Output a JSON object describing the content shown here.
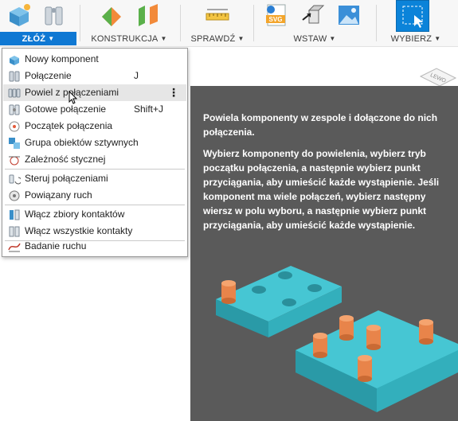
{
  "toolbar": {
    "groups": [
      {
        "label": "ZŁÓŻ",
        "caret": "▼"
      },
      {
        "label": "KONSTRUKCJA",
        "caret": "▼"
      },
      {
        "label": "SPRAWDŹ",
        "caret": "▼"
      },
      {
        "label": "WSTAW",
        "caret": "▼"
      },
      {
        "label": "WYBIERZ",
        "caret": "▼"
      }
    ]
  },
  "menu": {
    "items": [
      {
        "label": "Nowy komponent",
        "shortcut": "",
        "icon": "new-component-icon"
      },
      {
        "label": "Połączenie",
        "shortcut": "J",
        "icon": "joint-icon"
      },
      {
        "label": "Powiel z połączeniami",
        "shortcut": "",
        "icon": "duplicate-with-joints-icon",
        "more": "⋮"
      },
      {
        "label": "Gotowe połączenie",
        "shortcut": "Shift+J",
        "icon": "as-built-joint-icon"
      },
      {
        "label": "Początek połączenia",
        "shortcut": "",
        "icon": "joint-origin-icon"
      },
      {
        "label": "Grupa obiektów sztywnych",
        "shortcut": "",
        "icon": "rigid-group-icon"
      },
      {
        "label": "Zależność stycznej",
        "shortcut": "",
        "icon": "tangent-relationship-icon"
      },
      {
        "label": "Steruj połączeniami",
        "shortcut": "",
        "icon": "drive-joints-icon"
      },
      {
        "label": "Powiązany ruch",
        "shortcut": "",
        "icon": "motion-link-icon"
      },
      {
        "label": "Włącz zbiory kontaktów",
        "shortcut": "",
        "icon": "enable-contact-sets-icon"
      },
      {
        "label": "Włącz wszystkie kontakty",
        "shortcut": "",
        "icon": "enable-all-contact-icon"
      },
      {
        "label": "Badanie ruchu",
        "shortcut": "",
        "icon": "motion-study-icon"
      }
    ]
  },
  "tooltip": {
    "title": "Powiela komponenty w zespole i dołączone do nich połączenia.",
    "body": "Wybierz komponenty do powielenia, wybierz tryb początku połączenia, a następnie wybierz punkt przyciągania, aby umieścić każde wystąpienie. Jeśli komponent ma wiele połączeń, wybierz następny wiersz w polu wyboru, a następnie wybierz punkt przyciągania, aby umieścić każde wystąpienie."
  },
  "viewcube": {
    "face": "LEWO"
  },
  "colors": {
    "accent": "#0f78d3",
    "tooltip_bg": "#5a5a5a",
    "part": "#3fc1cf",
    "peg": "#e8844a"
  }
}
